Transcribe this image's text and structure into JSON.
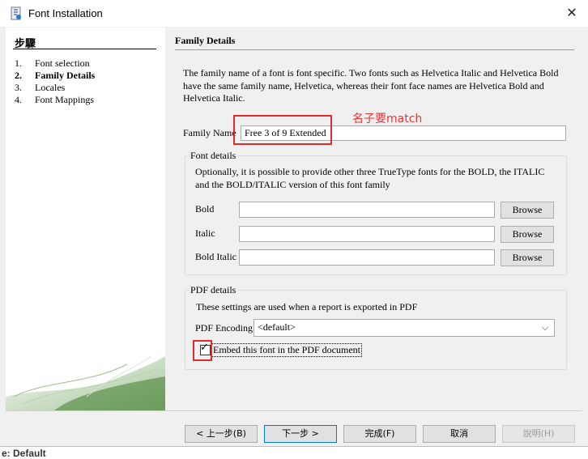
{
  "window": {
    "title": "Font Installation"
  },
  "steps": {
    "title": "步驟",
    "items": [
      {
        "num": "1.",
        "label": "Font selection"
      },
      {
        "num": "2.",
        "label": "Family Details"
      },
      {
        "num": "3.",
        "label": "Locales"
      },
      {
        "num": "4.",
        "label": "Font Mappings"
      }
    ]
  },
  "main": {
    "title": "Family Details",
    "description": "The family name of a font is font specific. Two fonts such as Helvetica Italic and Helvetica Bold have the same family name, Helvetica, whereas their font face names are Helvetica Bold and Helvetica Italic.",
    "family_name_label": "Family Name",
    "family_name_value": "Free 3 of 9 Extended",
    "annotation": "名子要match"
  },
  "font_details": {
    "title": "Font details",
    "description": "Optionally, it is possible to provide other three TrueType fonts for the BOLD, the ITALIC and the BOLD/ITALIC version of this font family",
    "rows": [
      {
        "label": "Bold",
        "value": "",
        "button": "Browse"
      },
      {
        "label": "Italic",
        "value": "",
        "button": "Browse"
      },
      {
        "label": "Bold Italic",
        "value": "",
        "button": "Browse"
      }
    ]
  },
  "pdf_details": {
    "title": "PDF details",
    "description": "These settings are used when a report is exported in PDF",
    "encoding_label": "PDF Encoding",
    "encoding_value": "<default>",
    "embed_label": "Embed this font in the PDF document",
    "embed_checked": true
  },
  "footer": {
    "back": "< 上一步(B)",
    "next": "下一步 >",
    "finish": "完成(F)",
    "cancel": "取消",
    "help": "說明(H)"
  },
  "background_peek": {
    "bottom_text": "e: Default"
  },
  "colors": {
    "annotation_red": "#e22b2b",
    "panel_bg": "#f0f0f0",
    "primary_border": "#0078d7"
  }
}
